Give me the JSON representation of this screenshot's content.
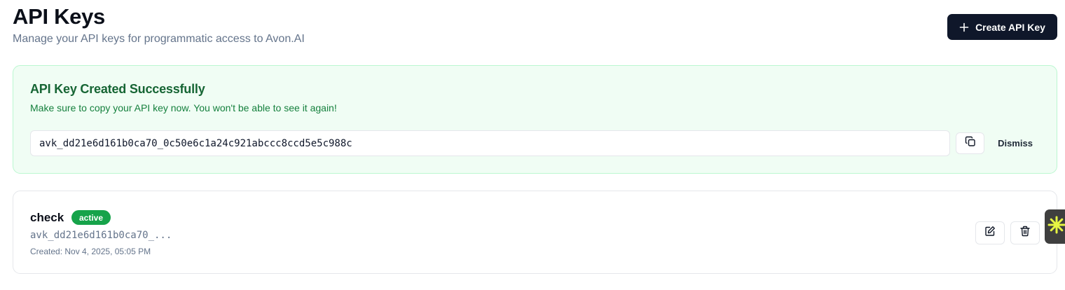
{
  "header": {
    "title": "API Keys",
    "subtitle": "Manage your API keys for programmatic access to Avon.AI",
    "create_button_label": "Create API Key",
    "create_button_icon": "plus-icon"
  },
  "success": {
    "title": "API Key Created Successfully",
    "description": "Make sure to copy your API key now. You won't be able to see it again!",
    "api_key": "avk_dd21e6d161b0ca70_0c50e6c1a24c921abccc8ccd5e5c988c",
    "copy_icon": "copy-icon",
    "dismiss_label": "Dismiss"
  },
  "keys": [
    {
      "name": "check",
      "status": "active",
      "preview": "avk_dd21e6d161b0ca70_...",
      "created": "Created: Nov 4, 2025, 05:05 PM",
      "edit_icon": "edit-icon",
      "delete_icon": "trash-icon"
    }
  ],
  "colors": {
    "primary_button": "#0f172a",
    "success_bg": "#f0fdf4",
    "success_border": "#bbf7d0",
    "success_title": "#166534",
    "success_text": "#15803d",
    "active_badge": "#16a34a",
    "widget_bg": "#3f3f3f",
    "widget_icon": "#e6f542"
  },
  "floating_widget_icon": "sparkle-icon"
}
